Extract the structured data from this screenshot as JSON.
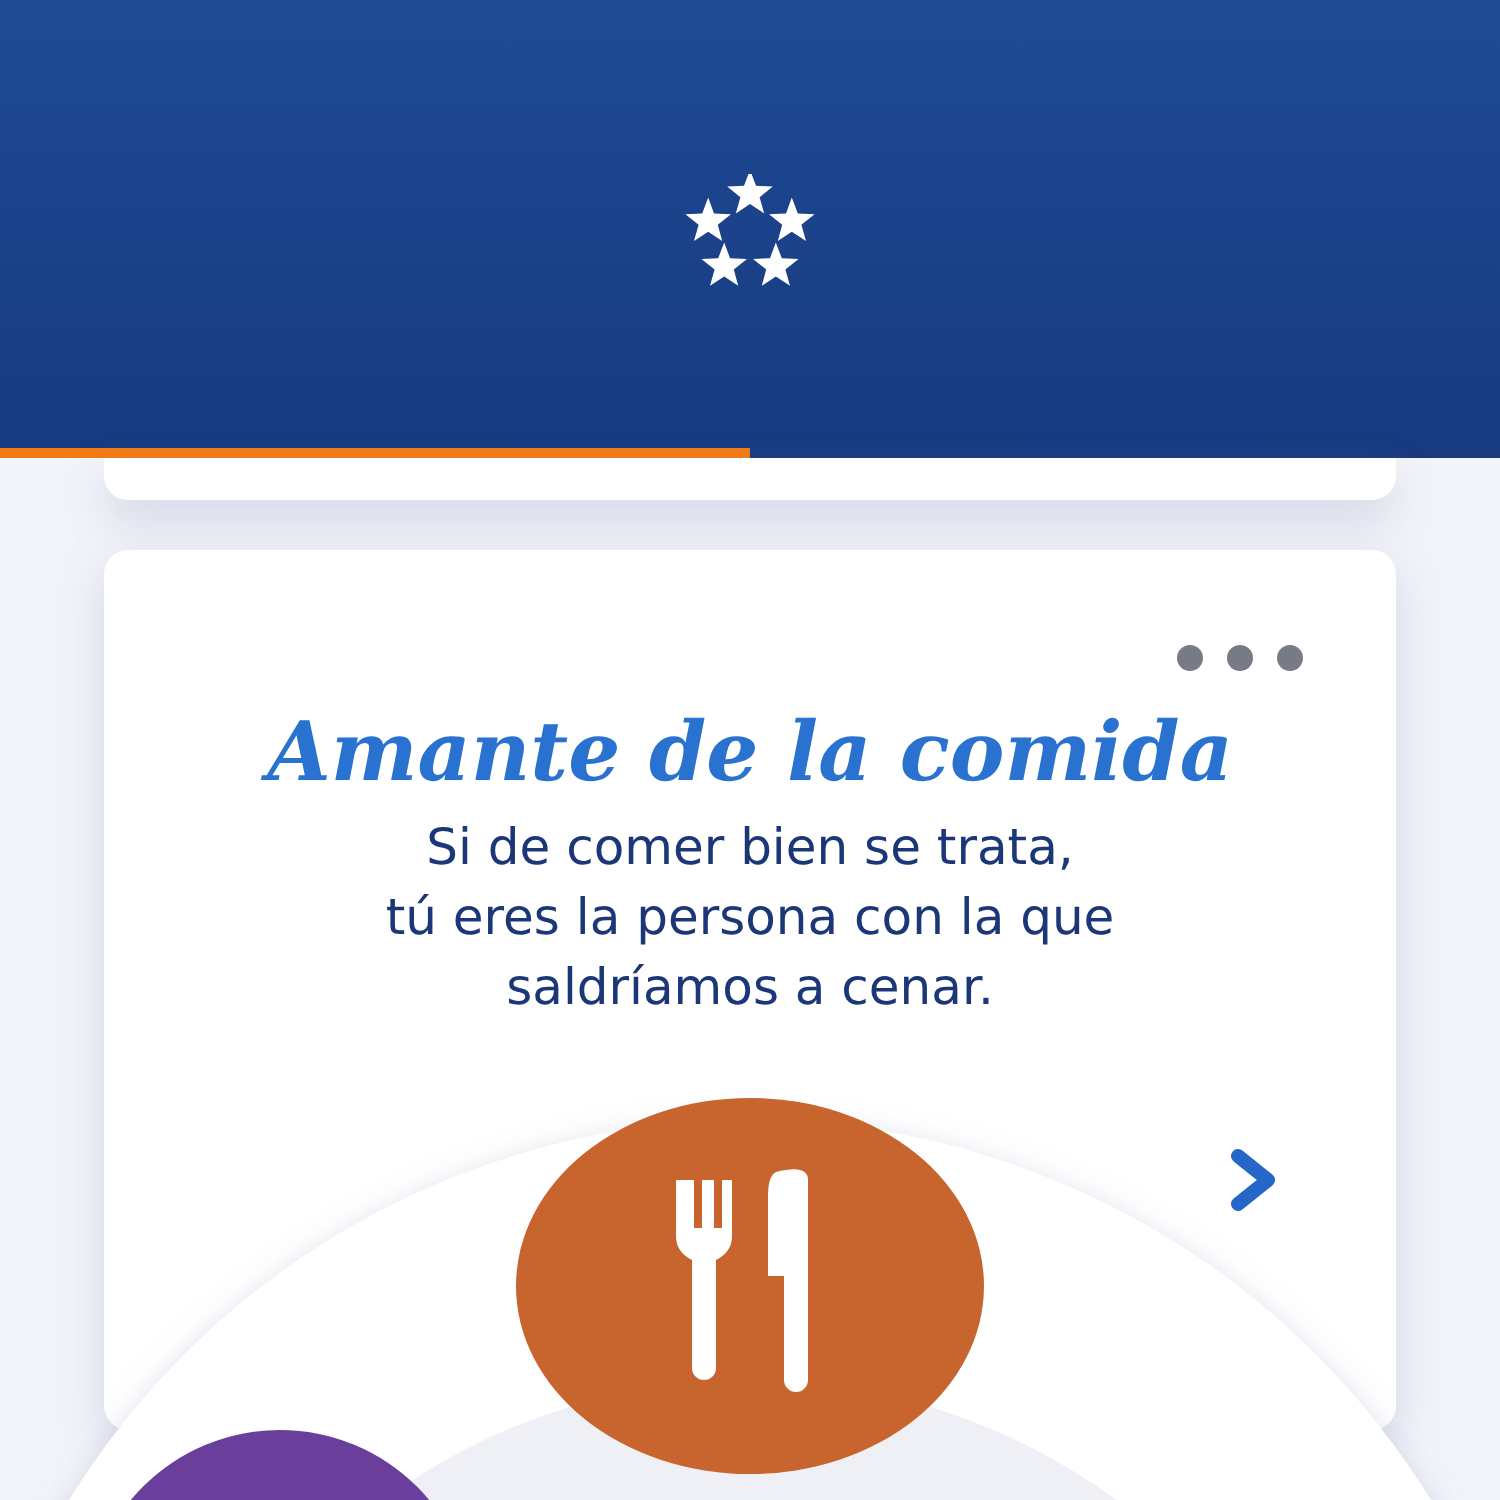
{
  "progress": {
    "level": 0.5
  },
  "card": {
    "title": "Amante de la comida",
    "text": "Si de comer bien se trata,\ntú eres la persona con la que\nsaldríamos a cenar."
  }
}
